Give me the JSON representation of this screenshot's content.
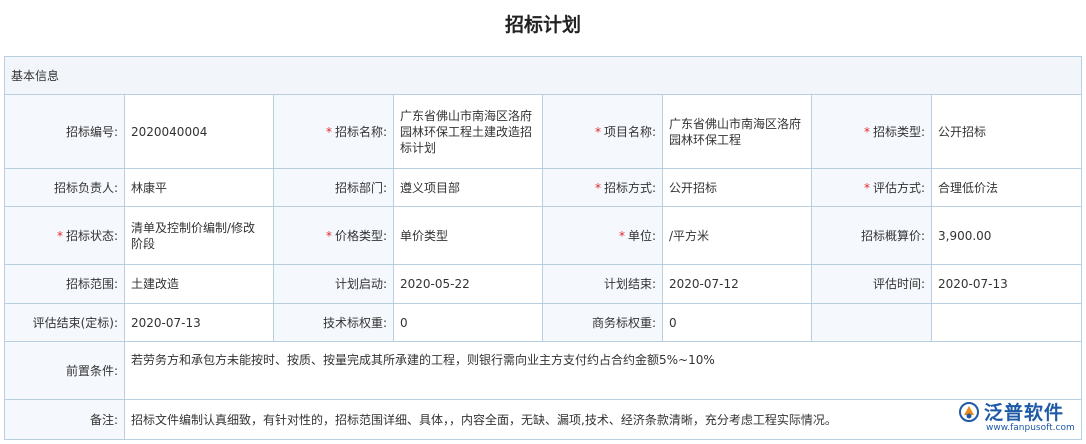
{
  "page": {
    "title": "招标计划"
  },
  "section": {
    "basic_info": "基本信息"
  },
  "fields": {
    "bid_no_label": "招标编号:",
    "bid_no": "2020040004",
    "bid_name_label": "招标名称:",
    "bid_name": "广东省佛山市南海区洛府园林环保工程土建改造招标计划",
    "project_name_label": "项目名称:",
    "project_name": "广东省佛山市南海区洛府园林环保工程",
    "bid_type_label": "招标类型:",
    "bid_type": "公开招标",
    "owner_label": "招标负责人:",
    "owner": "林康平",
    "dept_label": "招标部门:",
    "dept": "遵义项目部",
    "method_label": "招标方式:",
    "method": "公开招标",
    "eval_method_label": "评估方式:",
    "eval_method": "合理低价法",
    "status_label": "招标状态:",
    "status": "清单及控制价编制/修改阶段",
    "price_type_label": "价格类型:",
    "price_type": "单价类型",
    "unit_label": "单位:",
    "unit": "/平方米",
    "budget_label": "招标概算价:",
    "budget": "3,900.00",
    "scope_label": "招标范围:",
    "scope": "土建改造",
    "plan_start_label": "计划启动:",
    "plan_start": "2020-05-22",
    "plan_end_label": "计划结束:",
    "plan_end": "2020-07-12",
    "eval_time_label": "评估时间:",
    "eval_time": "2020-07-13",
    "eval_end_label": "评估结束(定标):",
    "eval_end": "2020-07-13",
    "tech_weight_label": "技术标权重:",
    "tech_weight": "0",
    "biz_weight_label": "商务标权重:",
    "biz_weight": "0",
    "precondition_label": "前置条件:",
    "precondition": "若劳务方和承包方未能按时、按质、按量完成其所承建的工程，则银行需向业主方支付约占合约金额5%~10%",
    "remark_label": "备注:",
    "remark": "招标文件编制认真细致，有针对性的，招标范围详细、具体，，内容全面，无缺、漏项,技术、经济条款清晰，充分考虑工程实际情况。"
  },
  "required_mark": "*",
  "brand": {
    "name": "泛普软件",
    "url": "www.fanpusoft.com",
    "icon": "fanpu-logo-icon"
  }
}
